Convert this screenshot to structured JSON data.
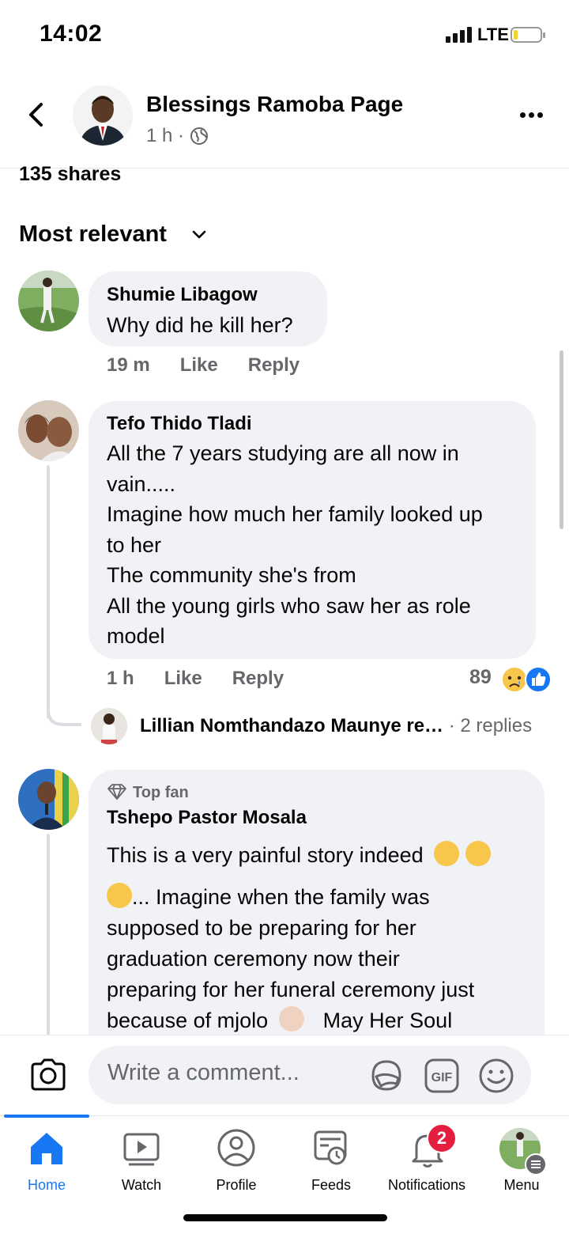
{
  "status_bar": {
    "time": "14:02",
    "network": "LTE"
  },
  "post_header": {
    "title": "Blessings Ramoba Page",
    "meta": "1 h ·"
  },
  "shares": "135 shares",
  "sort_label": "Most relevant",
  "comments": [
    {
      "name": "Shumie Libagow",
      "lines": [
        "Why did he kill her?"
      ],
      "time": "19 m",
      "like": "Like",
      "reply": "Reply"
    },
    {
      "name": "Tefo Thido Tladi",
      "lines": [
        "All the 7 years studying are all now in",
        "vain.....",
        "Imagine how much her family looked up",
        "to her",
        "The community she's from",
        "All the young girls who saw her as role",
        "model"
      ],
      "time": "1 h",
      "like": "Like",
      "reply": "Reply",
      "reactions_count": "89",
      "reply_preview": {
        "text": "Lillian Nomthandazo Maunye re…",
        "replies": "· 2 replies"
      }
    },
    {
      "badge": "Top fan",
      "name": "Tshepo Pastor Mosala",
      "lines": [
        "This is a very painful story  indeed",
        "... Imagine when the family was",
        "supposed to be preparing for her",
        "graduation ceremony now their",
        "preparing for her funeral ceremony just",
        "because of mjolo",
        "May Her Soul"
      ]
    }
  ],
  "composer": {
    "placeholder": "Write a comment..."
  },
  "tabs": [
    "Home",
    "Watch",
    "Profile",
    "Feeds",
    "Notifications",
    "Menu"
  ],
  "notifications_badge": "2",
  "colors": {
    "accent": "#1877f2",
    "bubble": "#f0f2f5",
    "badge": "#e41e3f"
  }
}
